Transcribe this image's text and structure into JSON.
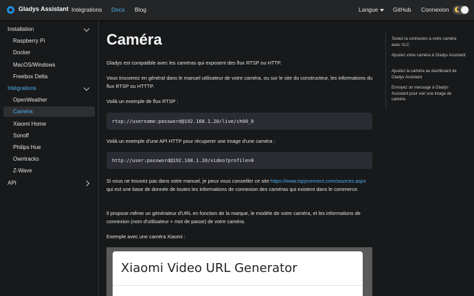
{
  "navbar": {
    "brand": "Gladys Assistant",
    "links": [
      "Intégrations",
      "Docs",
      "Blog"
    ],
    "language": "Langue",
    "github": "GitHub",
    "login": "Connexion"
  },
  "sidebar": {
    "items": [
      {
        "label": "Installation"
      },
      {
        "label": "Raspberry Pi"
      },
      {
        "label": "Docker"
      },
      {
        "label": "MacOS/Windows"
      },
      {
        "label": "Freebox Delta"
      },
      {
        "label": "Intégrations"
      },
      {
        "label": "OpenWeather"
      },
      {
        "label": "Caméra"
      },
      {
        "label": "Xiaomi Home"
      },
      {
        "label": "Sonoff"
      },
      {
        "label": "Philips Hue"
      },
      {
        "label": "Owntracks"
      },
      {
        "label": "Z-Wave"
      },
      {
        "label": "API"
      }
    ]
  },
  "main": {
    "title": "Caméra",
    "p1": "Gladys est compatible avec les caméras qui exposent des flux RTSP ou HTTP.",
    "p2": "Vous trouverez en général dans le manuel utilisateur de votre caméra, ou sur le site du constructeur, les informations du flux RTSP ou HTTTP.",
    "p3": "Voilà un exemple de flux RTSP :",
    "code1": "rtsp://username:password@192.168.1.20/live/ch00_0",
    "p4": "Voilà un exemple d'une API HTTP pour récuperer une image d'une caméra :",
    "code2": "http://user:password@192.168.1.20/video?profile=0",
    "p5_before": "Si vous ne trouvez pas dans votre manuel, je peux vous conseiller ce site ",
    "p5_link": "https://www.ispyconnect.com/sources.aspx",
    "p5_after": " qui est une base de donnée de toutes les informations de connexion des caméras qui existent dans le commerce.",
    "p6": "Il propose même un générateur d'URL en fonction de la marque, le modèle de votre caméra, et les informations de connexion (nom d'utilisateur + mot de passe) de votre caméra.",
    "p7": "Exemple avec une caméra Xiaomi :",
    "screenshot_title": "Xiaomi Video URL Generator"
  },
  "toc": {
    "items": [
      "Testez la connexion à votre caméra avec VLC",
      "Ajoutez votre caméra à Gladys Assistant",
      "Ajoutez la caméra au dashboard de Gladys Assistant",
      "Envoyez un message à Gladys Assistant pour voir une image de caméra"
    ]
  }
}
